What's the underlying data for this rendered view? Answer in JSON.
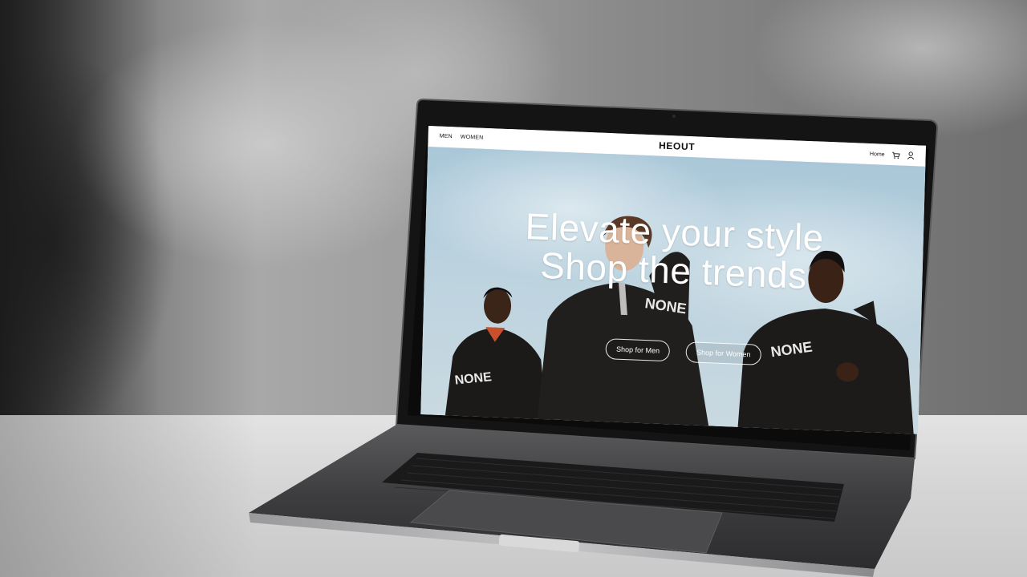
{
  "nav": {
    "links": [
      "MEN",
      "WOMEN"
    ],
    "brand": "HEOUT",
    "home": "Home",
    "cart_icon": "cart-icon",
    "account_icon": "user-icon"
  },
  "hero": {
    "headline_line1": "Elevate your style",
    "headline_line2": "Shop the trends",
    "cta_men": "Shop for Men",
    "cta_women": "Shop for Women"
  },
  "print": {
    "left_hoodie": "NONE",
    "center_hoodie": "NONE",
    "right_hoodie": "NONE"
  },
  "colors": {
    "sky": "#bcd3df",
    "hoodie": "#1b1a19",
    "laptop_frame": "#151515",
    "laptop_body": "#3f3f41"
  }
}
